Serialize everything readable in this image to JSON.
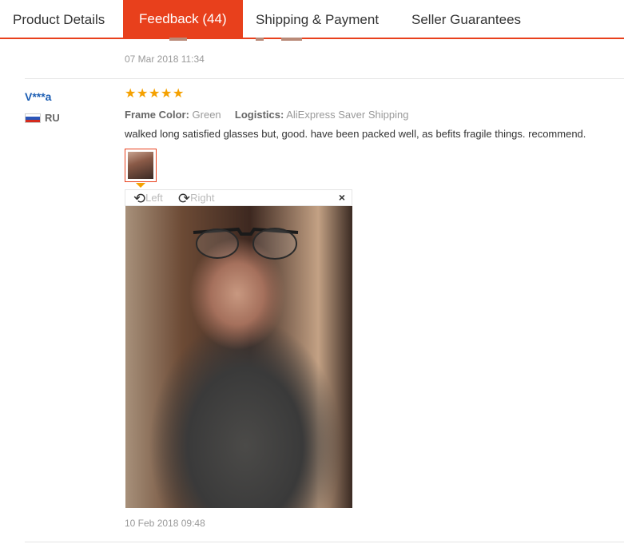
{
  "tabs": [
    {
      "label": "Product Details"
    },
    {
      "label": "Feedback (44)"
    },
    {
      "label": "Shipping & Payment"
    },
    {
      "label": "Seller Guarantees"
    }
  ],
  "previous_review": {
    "date": "07 Mar 2018 11:34"
  },
  "review": {
    "user": "V***a",
    "country_code": "RU",
    "rating": 5,
    "attributes": [
      {
        "label": "Frame Color:",
        "value": "Green"
      },
      {
        "label": "Logistics:",
        "value": "AliExpress Saver Shipping"
      }
    ],
    "text": "walked long satisfied glasses but, good. have been packed well, as befits fragile things. recommend.",
    "viewer": {
      "rotate_left": "Left",
      "rotate_right": "Right",
      "close": "×"
    },
    "date": "10 Feb 2018 09:48"
  },
  "colors": {
    "accent": "#e8401c",
    "star": "#f5a100",
    "username": "#1e5fb4"
  }
}
